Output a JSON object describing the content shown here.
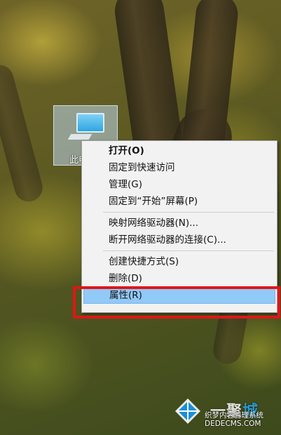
{
  "desktop": {
    "icon_label": "此电"
  },
  "context_menu": {
    "items": [
      {
        "label": "打开(O)"
      },
      {
        "label": "固定到快速访问"
      },
      {
        "label": "管理(G)"
      },
      {
        "label": "固定到“开始”屏幕(P)"
      },
      {
        "label": "映射网络驱动器(N)..."
      },
      {
        "label": "断开网络驱动器的连接(C)..."
      },
      {
        "label": "创建快捷方式(S)"
      },
      {
        "label": "删除(D)"
      },
      {
        "label": "属性(R)"
      }
    ]
  },
  "watermark": {
    "brand": "一聚",
    "brand_accent": "城",
    "line1": "织梦内容管理系统",
    "line2": "DEDECMS.COM"
  },
  "colors": {
    "highlight": "#91c9f7",
    "annotation_box": "#e01616"
  }
}
